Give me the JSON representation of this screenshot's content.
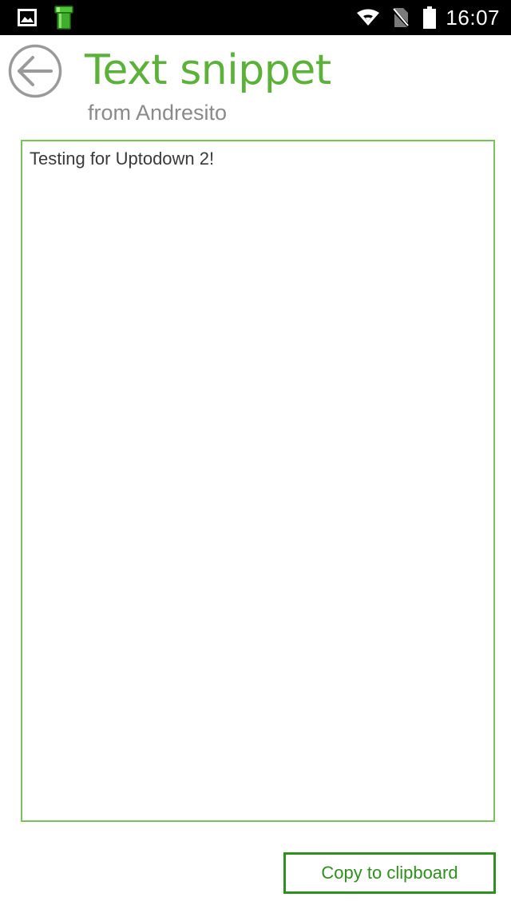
{
  "status_bar": {
    "time": "16:07",
    "left_icons": [
      "gallery-icon",
      "green-pipe-app-icon"
    ],
    "right_icons": [
      "wifi-icon",
      "no-sim-icon",
      "battery-icon"
    ]
  },
  "header": {
    "back_icon": "back-arrow-icon",
    "title": "Text snippet",
    "subtitle": "from Andresito"
  },
  "snippet": {
    "text": "Testing for Uptodown 2!"
  },
  "actions": {
    "copy_label": "Copy to clipboard"
  },
  "colors": {
    "accent": "#5cb13a",
    "box_border": "#7cc25c",
    "button_accent": "#2f8f1f",
    "subtitle": "#8a8a8a",
    "status_bar_bg": "#000000"
  }
}
